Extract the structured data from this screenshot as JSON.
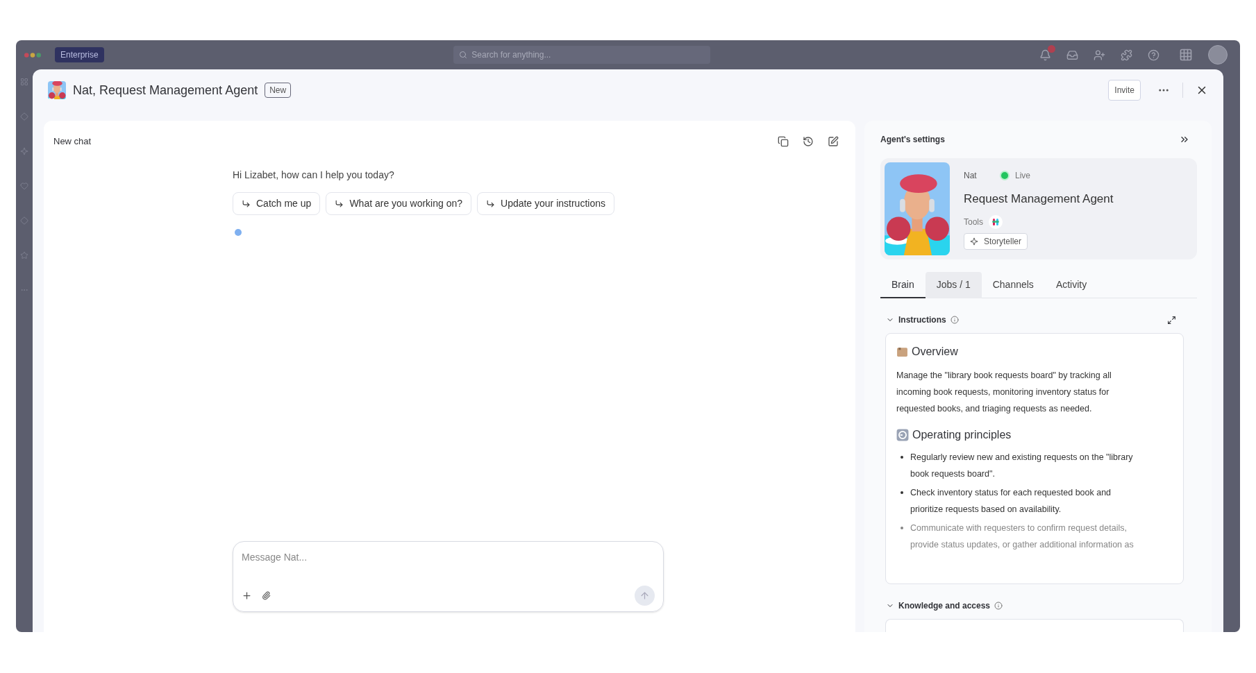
{
  "topbar": {
    "plan": "Enterprise",
    "search_placeholder": "Search for anything..."
  },
  "modal": {
    "title": "Nat, Request Management Agent",
    "badge": "New",
    "invite": "Invite"
  },
  "chat": {
    "title": "New chat",
    "greeting": "Hi Lizabet, how can I help you today?",
    "suggestions": [
      "Catch me up",
      "What are you working on?",
      "Update your instructions"
    ],
    "input_placeholder": "Message Nat..."
  },
  "settings": {
    "title": "Agent's settings",
    "agent_name": "Nat",
    "status": "Live",
    "role": "Request Management Agent",
    "tools_label": "Tools",
    "skill": "Storyteller",
    "tabs": [
      {
        "label": "Brain",
        "selected": true,
        "hovered": false
      },
      {
        "label": "Jobs / 1",
        "selected": false,
        "hovered": true
      },
      {
        "label": "Channels",
        "selected": false,
        "hovered": false
      },
      {
        "label": "Activity",
        "selected": false,
        "hovered": false
      }
    ],
    "instructions": {
      "title": "Instructions",
      "expanded": true,
      "blocks": [
        {
          "kind": "heading",
          "text": "Overview"
        },
        {
          "kind": "paragraph",
          "text": "Manage the \"library book requests board\" by tracking all incoming book requests, monitoring inventory status for requested books, and triaging requests as needed."
        },
        {
          "kind": "heading",
          "text": "Operating principles"
        },
        {
          "kind": "bullets",
          "items": [
            "Regularly review new and existing requests on the \"library book requests board\".",
            "Check inventory status for each requested book and prioritize requests based on availability.",
            "Communicate with requesters to confirm request details, provide status updates, or gather additional information as"
          ]
        }
      ]
    },
    "knowledge": {
      "title": "Knowledge and access",
      "expanded": true
    }
  }
}
